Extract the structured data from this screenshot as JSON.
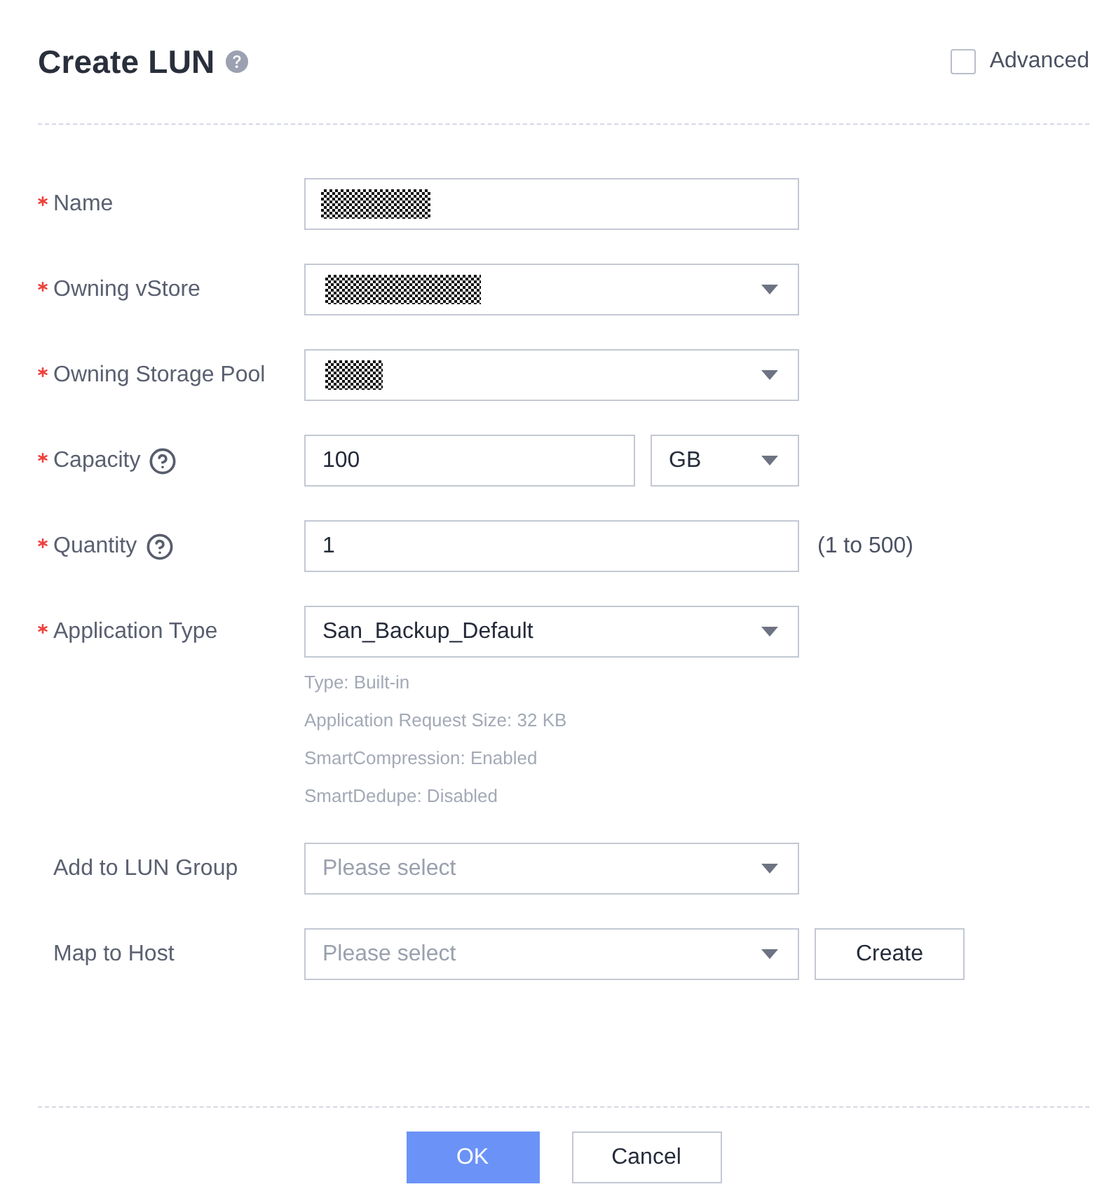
{
  "dialog": {
    "title": "Create LUN",
    "title_help": true,
    "advanced": {
      "label": "Advanced",
      "checked": false
    }
  },
  "fields": [
    {
      "kind": "text",
      "label": "Name",
      "required": true,
      "help": false,
      "redacted": true
    },
    {
      "kind": "select",
      "label": "Owning vStore",
      "required": true,
      "help": false,
      "redacted": true
    },
    {
      "kind": "select",
      "label": "Owning Storage Pool",
      "required": true,
      "help": false,
      "redacted": true
    },
    {
      "kind": "capacity",
      "label": "Capacity",
      "required": true,
      "help": true,
      "value": "100",
      "unit": "GB"
    },
    {
      "kind": "text",
      "label": "Quantity",
      "required": true,
      "help": true,
      "value": "1",
      "hint": "(1 to 500)"
    },
    {
      "kind": "select",
      "label": "Application Type",
      "required": true,
      "help": false,
      "value": "San_Backup_Default",
      "details": [
        "Type: Built-in",
        "Application Request Size: 32 KB",
        "SmartCompression: Enabled",
        "SmartDedupe: Disabled"
      ]
    },
    {
      "kind": "select",
      "label": "Add to LUN Group",
      "required": false,
      "help": false,
      "placeholder": "Please select"
    },
    {
      "kind": "select",
      "label": "Map to Host",
      "required": false,
      "help": false,
      "placeholder": "Please select",
      "action": "Create"
    }
  ],
  "buttons": [
    {
      "label": "OK",
      "kind": "primary"
    },
    {
      "label": "Cancel",
      "kind": "secondary"
    }
  ]
}
